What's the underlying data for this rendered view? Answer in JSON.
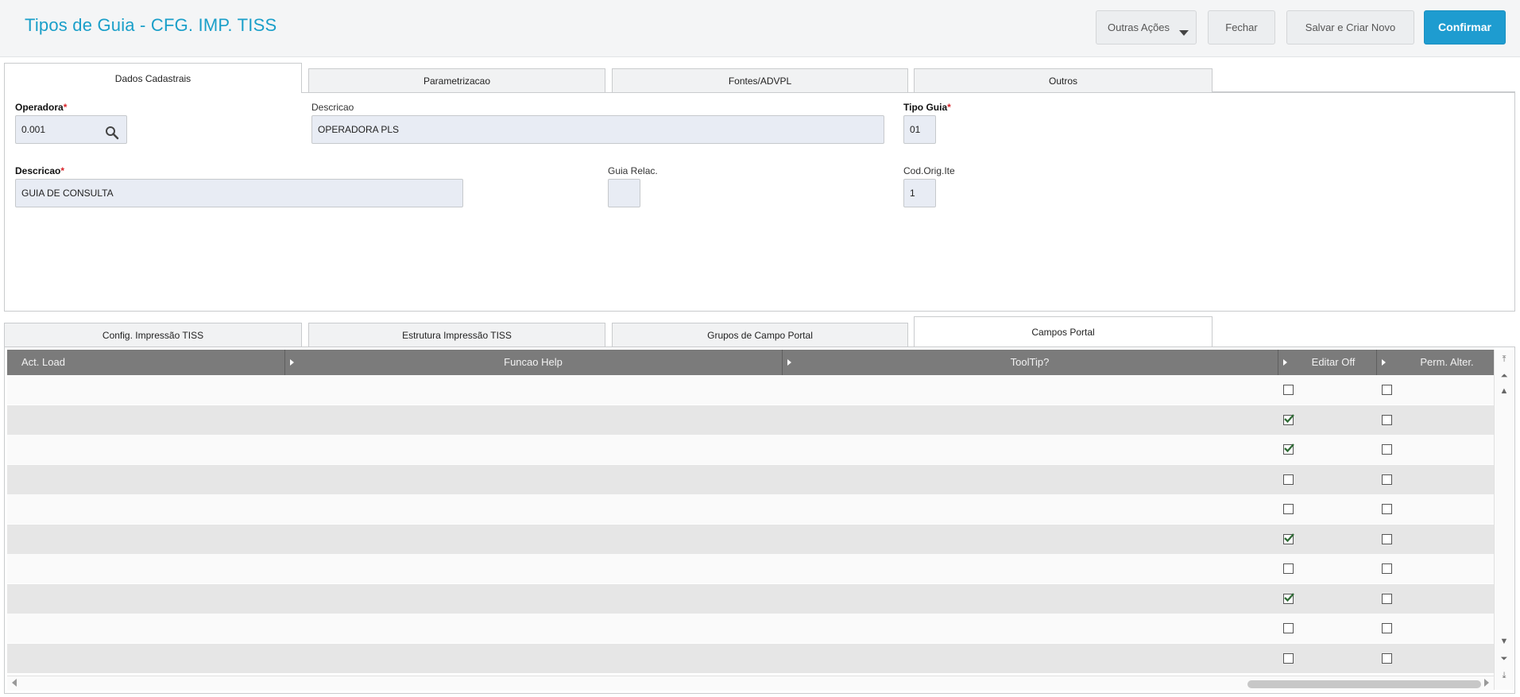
{
  "header": {
    "title": "Tipos de Guia - CFG. IMP. TISS",
    "buttons": {
      "outras_acoes": "Outras Ações",
      "fechar": "Fechar",
      "salvar_criar_novo": "Salvar e Criar Novo",
      "confirmar": "Confirmar"
    }
  },
  "top_tabs": [
    "Dados Cadastrais",
    "Parametrizacao",
    "Fontes/ADVPL",
    "Outros"
  ],
  "form": {
    "operadora": {
      "label": "Operadora",
      "value": "0.001"
    },
    "descricao_oper": {
      "label": "Descricao",
      "value": "OPERADORA PLS"
    },
    "tipo_guia": {
      "label": "Tipo Guia",
      "value": "01"
    },
    "descricao": {
      "label": "Descricao",
      "value": "GUIA DE CONSULTA"
    },
    "guia_relac": {
      "label": "Guia Relac.",
      "value": ""
    },
    "cod_orig_ite": {
      "label": "Cod.Orig.Ite",
      "value": "1"
    },
    "required_mark": "*"
  },
  "bottom_tabs": [
    "Config. Impressão TISS",
    "Estrutura Impressão TISS",
    "Grupos de Campo Portal",
    "Campos Portal"
  ],
  "grid": {
    "columns": [
      "Act. Load",
      "Funcao Help",
      "ToolTip?",
      "Editar Off",
      "Perm. Alter."
    ],
    "rows": [
      {
        "editar_off": false,
        "perm_alter": false
      },
      {
        "editar_off": true,
        "perm_alter": false
      },
      {
        "editar_off": true,
        "perm_alter": false
      },
      {
        "editar_off": false,
        "perm_alter": false
      },
      {
        "editar_off": false,
        "perm_alter": false
      },
      {
        "editar_off": true,
        "perm_alter": false
      },
      {
        "editar_off": false,
        "perm_alter": false
      },
      {
        "editar_off": true,
        "perm_alter": false
      },
      {
        "editar_off": false,
        "perm_alter": false
      },
      {
        "editar_off": false,
        "perm_alter": false
      }
    ]
  },
  "colors": {
    "accent": "#1a9fc9",
    "primary_button": "#1e9cd0",
    "grid_header": "#7b7b7b",
    "required": "#d9252a"
  }
}
